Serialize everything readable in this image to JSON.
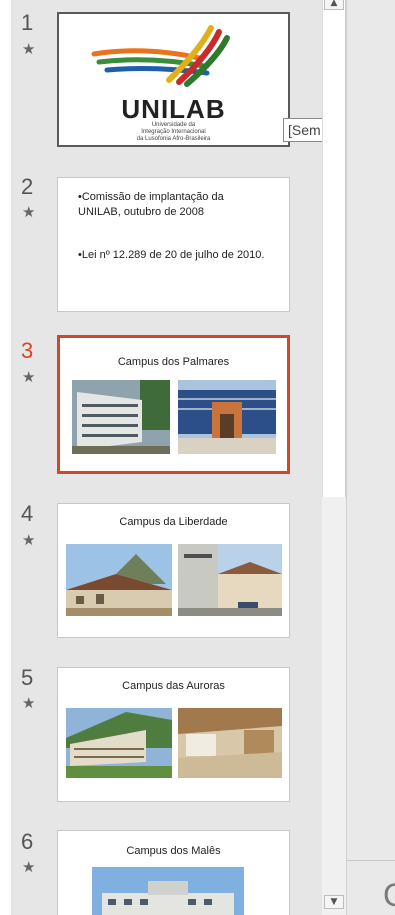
{
  "tooltip": {
    "text": "[Sem título]"
  },
  "slides": [
    {
      "number": "1",
      "logo_text": "UNILAB",
      "logo_subtitle_1": "Universidade da",
      "logo_subtitle_2": "Integração Internacional",
      "logo_subtitle_3": "da Lusofonia Afro-Brasileira"
    },
    {
      "number": "2",
      "bullet_1": "•Comissão de implantação da UNILAB, outubro de 2008",
      "bullet_2": "•Lei nº 12.289 de 20 de julho de 2010."
    },
    {
      "number": "3",
      "title": "Campus dos Palmares"
    },
    {
      "number": "4",
      "title": "Campus da Liberdade"
    },
    {
      "number": "5",
      "title": "Campus das Auroras"
    },
    {
      "number": "6",
      "title": "Campus dos Malês"
    }
  ],
  "right_panel": {
    "partial_letter": "C"
  },
  "colors": {
    "accent": "#d24726",
    "pane": "#e6e6e6"
  },
  "icons": {
    "transition": "star-icon",
    "scroll_up": "arrow-up-icon",
    "scroll_down": "arrow-down-icon"
  }
}
